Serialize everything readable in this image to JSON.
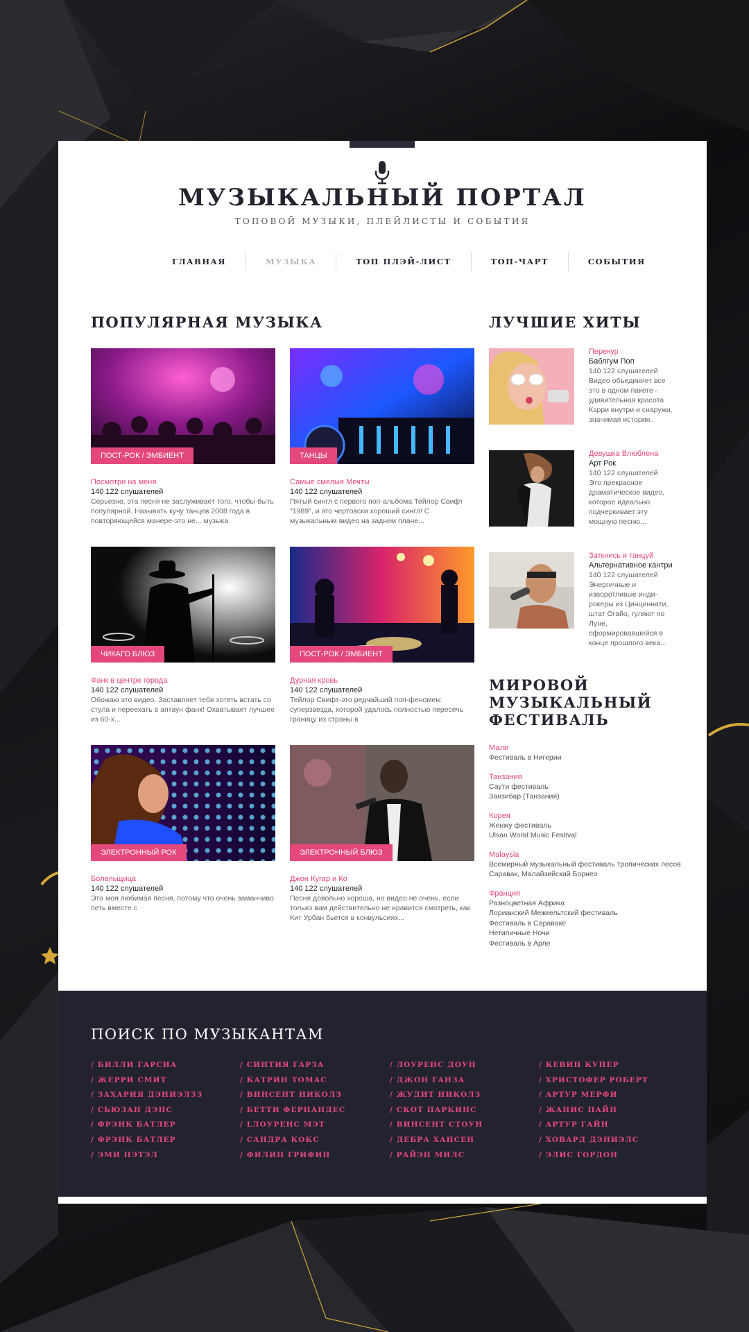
{
  "site": {
    "title": "МУЗЫКАЛЬНЫЙ ПОРТАЛ",
    "subtitle": "ТОПОВОЙ МУЗЫКИ, ПЛЕЙЛИСТЫ И СОБЫТИЯ",
    "logo_icon": "microphone-icon"
  },
  "nav": [
    {
      "label": "ГЛАВНАЯ",
      "active": false
    },
    {
      "label": "МУЗЫКА",
      "active": true
    },
    {
      "label": "ТОП ПЛЭЙ-ЛИСТ",
      "active": false
    },
    {
      "label": "ТОП-ЧАРТ",
      "active": false
    },
    {
      "label": "СОБЫТИЯ",
      "active": false
    }
  ],
  "popular": {
    "heading": "ПОПУЛЯРНАЯ МУЗЫКА",
    "items": [
      {
        "tag": "ПОСТ-РОК / ЭМБИЕНТ",
        "title": "Посмотри на меня",
        "listeners": "140 122 слушателей",
        "desc": "Серьезно, эта песня не заслуживает того, чтобы быть популярной. Называть кучу танцев 2008 года в повторяющейся манере-это не... музыка"
      },
      {
        "tag": "ТАНЦЫ",
        "title": "Самые смелые Мечты",
        "listeners": "140 122 слушателей",
        "desc": "Пятый сингл с первого поп-альбома Тейлор Свифт \"1989\", и это чертовски хороший сингл! С музыкальным видео на заднем плане..."
      },
      {
        "tag": "ЧИКАГО БЛЮЗ",
        "title": "Фанк в центре города",
        "listeners": "140 122 слушателей",
        "desc": "Обожаю это видео. Заставляет тебя хотеть встать со стула и переехать в аптаун фанк! Охватывает лучшее из 60-х..."
      },
      {
        "tag": "ПОСТ-РОК / ЭМБИЕНТ",
        "title": "Дурная кровь",
        "listeners": "140 122 слушателей",
        "desc": "Тейлор Свифт-это редчайший поп-феномен: суперзвезда, которой удалось полностью пересечь границу из страны в"
      },
      {
        "tag": "ЭЛЕКТРОННЫЙ РОК",
        "title": "Болельщица",
        "listeners": "140 122 слушателей",
        "desc": "Это моя любимая песня, потому что очень заманчиво петь вместе с"
      },
      {
        "tag": "ЭЛЕКТРОННЫЙ БЛЮЗ",
        "title": "Джон Кугар и Ко",
        "listeners": "140 122 слушателей",
        "desc": "Песня довольно хороша, но видео не очень, если только вам действительно не нравится смотреть, как Кит Урбан бьется в конвульсиях..."
      }
    ]
  },
  "hits": {
    "heading": "ЛУЧШИЕ ХИТЫ",
    "items": [
      {
        "title": "Перекур",
        "genre": "Баблгум Поп",
        "listeners": "140 122 слушателей",
        "desc": "Видео объединяет все это в одном пакете - удивительная красота Кэрри внутри и снаружи, значимая история.."
      },
      {
        "title": "Девушка Влюблена",
        "genre": "Арт Рок",
        "listeners": "140 122 слушателей",
        "desc": "Это прекрасное драматическое видео, которое идеально подчеркивает эту мощную песню..."
      },
      {
        "title": "Заткнись и танцуй",
        "genre": "Альтернативное кантри",
        "listeners": "140 122 слушателей",
        "desc": "Энергичные и изворотливые инди-рокеры из Цинциннати, штат Огайо, гуляют по Луне, сформировавшейся в конце прошлого века..."
      }
    ]
  },
  "festival": {
    "heading": [
      "МИРОВОЙ",
      "МУЗЫКАЛЬНЫЙ",
      "ФЕСТИВАЛЬ"
    ],
    "groups": [
      {
        "country": "Мали",
        "events": [
          "Фестиваль в Нигерии"
        ]
      },
      {
        "country": "Танзания",
        "events": [
          "Саути фестиваль",
          "Занзибар (Танзания)"
        ]
      },
      {
        "country": "Корея",
        "events": [
          "Женжу фестиваль",
          "Ulsan World Music Festival"
        ]
      },
      {
        "country": "Malaysia",
        "events": [
          "Всемирный музыкальный фестиваль тропических лесов",
          "Саравак, Малайзийский Борнео"
        ]
      },
      {
        "country": "Франция",
        "events": [
          "Разноцветная Африка",
          "Лорианский Межкельтский фестиваль",
          "Фестиваль в Сараваке",
          "Нетипичные Ночи",
          "Фестиваль в Арле"
        ]
      }
    ]
  },
  "footer": {
    "heading": "ПОИСК ПО МУЗЫКАНТАМ",
    "columns": [
      [
        "/ БИЛЛИ ГАРСИА",
        "/ ЖЕРРИ СМИТ",
        "/ ЗАХАРИЯ ДЭНИЭЛЗЗ",
        "/ СЬЮЗАН ДЭНС",
        "/ ФРЭНК БАТЛЕР",
        "/ ФРЭНК БАТЛЕР",
        "/ ЭМИ ПЭТЭЛ"
      ],
      [
        "/ СИНТИЯ ГАРЗА",
        "/ КАТРИН ТОМАС",
        "/ ВИНСЕНТ НИКОЛЗ",
        "/ БЕТТИ ФЕРНАНДЕС",
        "/ LЛОУРЕНС МЭТ",
        "/ САНДРА КОКС",
        "/ ФИЛИП ГРИФИН"
      ],
      [
        "/ ЛОУРЕНС ДОУН",
        "/ ДЖОН ГАНЗА",
        "/ ЖУДИТ НИКОЛЗ",
        "/ СКОТ ПАРКИНС",
        "/ ВИНСЕНТ СТОУН",
        "/ ДЕБРА ХАНСЕН",
        "/ РАЙЭН МИЛС"
      ],
      [
        "/ КЕВИН КУПЕР",
        "/ ХРИСТОФЕР РОБЕРТ",
        "/ АРТУР МЕРФИ",
        "/ ЖАНИС ПАЙН",
        "/ АРТУР ГАЙН",
        "/ ХОВАРД ДЭНИЭЛС",
        "/ ЭЛИС ГОРДОН"
      ]
    ]
  },
  "colors": {
    "accent": "#e4487a",
    "dark": "#22232f",
    "gold": "#d4a83a"
  }
}
